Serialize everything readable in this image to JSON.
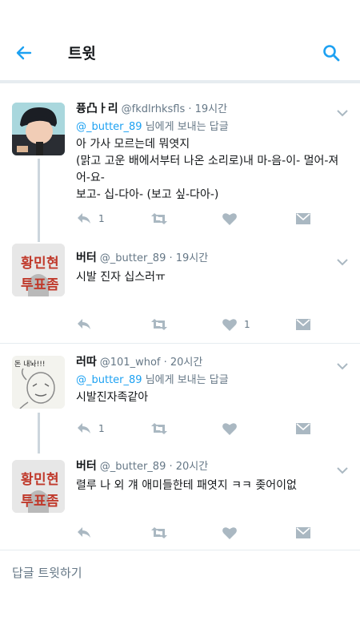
{
  "header": {
    "title": "트윗",
    "back_icon": "back-arrow-icon",
    "search_icon": "search-icon",
    "accent": "#1da1f2"
  },
  "tweets": [
    {
      "name": "퓽凸ㅏ리",
      "handle": "@fkdlrhksfls",
      "time": "· 19시간",
      "reply_handle": "@_butter_89",
      "reply_suffix": " 님에게 보내는 답글",
      "text": "아 가사 모르는데 뭐엿지\n(맑고 고운 배에서부터 나온 소리로)내 마-음-이- 멀어-져어-요-\n보고- 십-다아- (보고 싶-다아-)",
      "reply_count": "1",
      "like_count": ""
    },
    {
      "name": "버터",
      "handle": "@_butter_89",
      "time": "· 19시간",
      "text": "시발 진자 십스러ㅠ",
      "avatar_text": [
        "황",
        "민",
        "현",
        "투",
        "표",
        "좀"
      ],
      "reply_count": "",
      "like_count": "1"
    },
    {
      "name": "러따",
      "handle": "@101_whof",
      "time": "· 20시간",
      "reply_handle": "@_butter_89",
      "reply_suffix": " 님에게 보내는 답글",
      "text": "시발진자족같아",
      "avatar_text": "돈 내놔!!!",
      "reply_count": "1",
      "like_count": ""
    },
    {
      "name": "버터",
      "handle": "@_butter_89",
      "time": "· 20시간",
      "text": "렬루 나 외 걔 애미들한테 패엿지 ㅋㅋ 좆어이없",
      "avatar_text": [
        "황",
        "민",
        "현",
        "투",
        "표",
        "좀"
      ],
      "reply_count": "",
      "like_count": ""
    }
  ],
  "compose": {
    "placeholder": "답글 트윗하기"
  },
  "icons": {
    "reply": "reply-icon",
    "retweet": "retweet-icon",
    "like": "heart-icon",
    "dm": "envelope-icon",
    "more": "chevron-down-icon"
  }
}
